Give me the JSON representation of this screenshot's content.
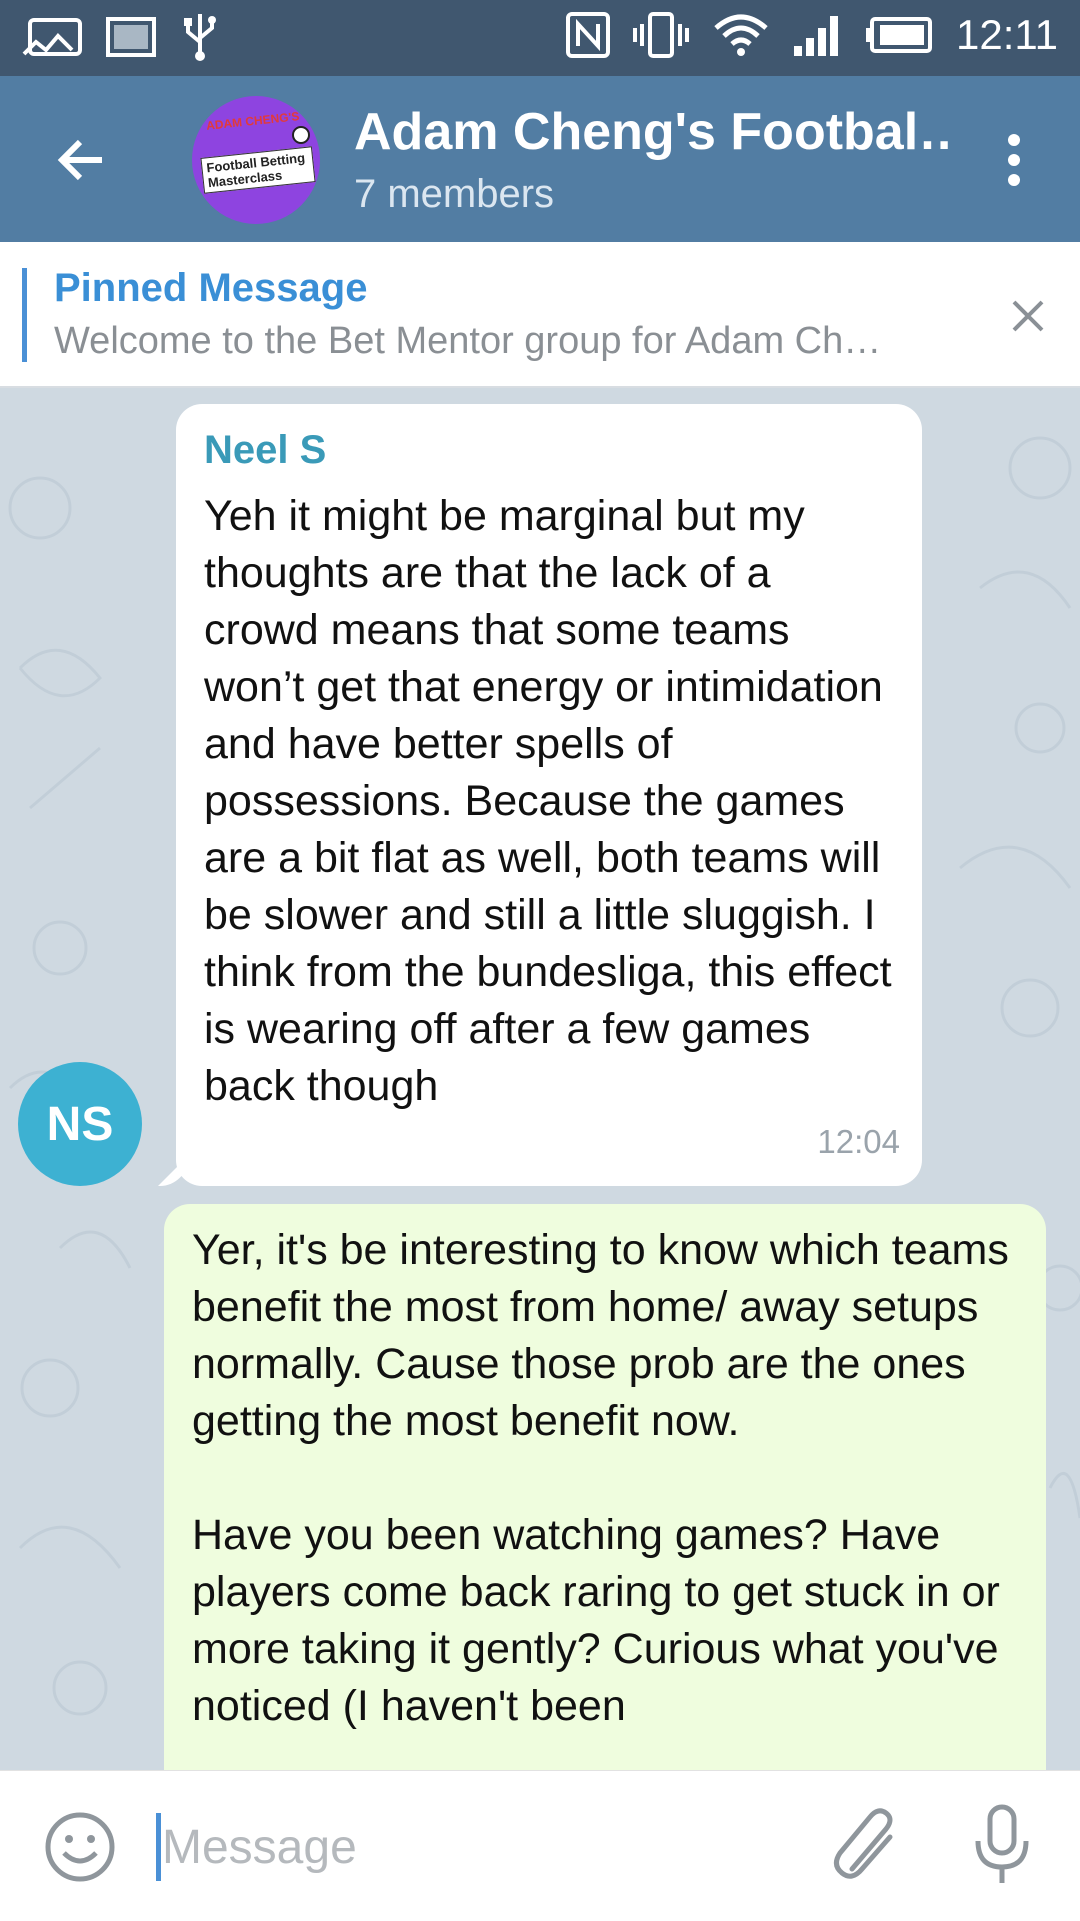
{
  "status_bar": {
    "time": "12:11",
    "left_icons": [
      "image-message-icon",
      "picture-icon",
      "usb-icon"
    ],
    "right_icons": [
      "nfc-icon",
      "vibrate-icon",
      "wifi-icon",
      "signal-icon",
      "battery-icon"
    ]
  },
  "header": {
    "title": "Adam Cheng's Footbal…",
    "subtitle": "7 members",
    "avatar": {
      "line1": "ADAM CHENG'S",
      "line2": "Football Betting Masterclass"
    },
    "bg_color": "#527da3"
  },
  "pinned": {
    "title": "Pinned Message",
    "text": "Welcome to the Bet Mentor group for Adam Ch…"
  },
  "messages": [
    {
      "direction": "incoming",
      "sender": "Neel S",
      "sender_initials": "NS",
      "text": "Yeh it might be marginal but my thoughts are that the lack of a crowd means that some teams won’t get that energy or intimidation and have better spells of possessions. Because the games are a bit flat as well, both teams will be slower and still a little sluggish. I think from the bundesliga, this effect is wearing off after a few games back though",
      "time": "12:04"
    },
    {
      "direction": "outgoing",
      "text": "Yer, it's be interesting to know which teams benefit the most from home/ away setups normally. Cause those prob are the ones getting the most benefit now.\n\nHave you been watching games? Have players come back raring to get stuck in or more taking it gently? Curious what you've noticed (I haven't been"
    }
  ],
  "input": {
    "placeholder": "Message",
    "value": ""
  },
  "colors": {
    "status_bar": "#40576f",
    "accent": "#4a90d6",
    "incoming_bubble": "#ffffff",
    "outgoing_bubble": "#effdde",
    "chat_bg": "#cfd9e1",
    "sender_name": "#3a9ab8"
  }
}
